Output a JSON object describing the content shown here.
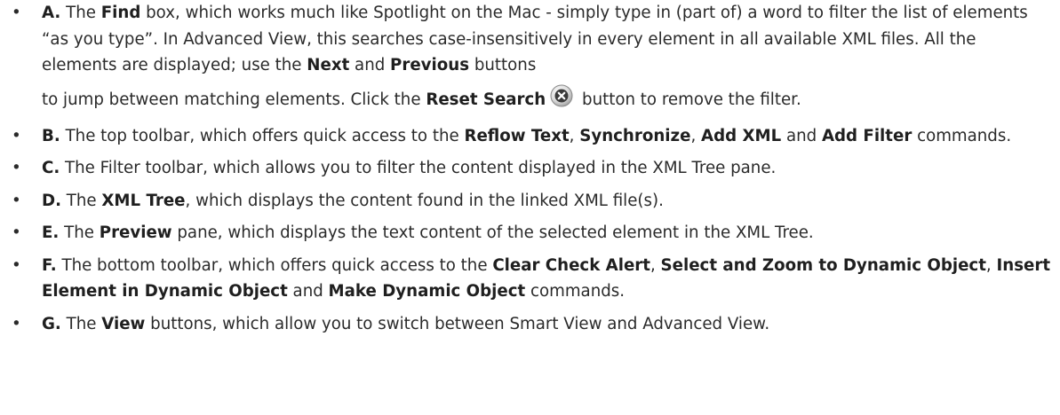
{
  "bullet": "•",
  "items": [
    {
      "letter": "A.",
      "t1": " The ",
      "k1": "Find",
      "t2": " box, which works much like Spotlight on the Mac - simply type in (part of) a word to filter the list of elements “as you type”. In Advanced View, this searches case-insensitively in every element in all available XML files. All the elements are displayed; use the ",
      "k2": "Next",
      "t3": " and ",
      "k3": "Previous",
      "t4": " buttons",
      "t5": "to jump between matching elements. Click the ",
      "k4": "Reset Search",
      "t6": " button to remove the filter."
    },
    {
      "letter": "B.",
      "t1": " The top toolbar, which offers quick access to the ",
      "k1": "Reflow Text",
      "t2": ", ",
      "k2": "Synchronize",
      "t3": ", ",
      "k3": "Add XML",
      "t4": " and ",
      "k4": "Add Filter",
      "t5": " commands."
    },
    {
      "letter": "C.",
      "t1": " The Filter toolbar, which allows you to filter the content displayed in the XML Tree pane."
    },
    {
      "letter": "D.",
      "t1": " The ",
      "k1": "XML Tree",
      "t2": ", which displays the content found in the linked XML file(s)."
    },
    {
      "letter": "E.",
      "t1": " The ",
      "k1": "Preview",
      "t2": " pane, which displays the text content of the selected element in the XML Tree."
    },
    {
      "letter": "F.",
      "t1": " The bottom toolbar, which offers quick access to the ",
      "k1": "Clear Check Alert",
      "t2": ", ",
      "k2": "Select and Zoom to Dynamic Object",
      "t3": ", ",
      "k3": "Insert Element in Dynamic Object",
      "t4": " and ",
      "k4": "Make Dynamic Object",
      "t5": " commands."
    },
    {
      "letter": "G.",
      "t1": " The ",
      "k1": "View",
      "t2": " buttons, which allow you to switch between Smart View and Advanced View."
    }
  ],
  "icons": {
    "reset_search": "reset-search-icon",
    "bullet": "bullet-icon"
  },
  "colors": {
    "text": "#2a2a2a",
    "icon_dark": "#3a3a3a"
  }
}
